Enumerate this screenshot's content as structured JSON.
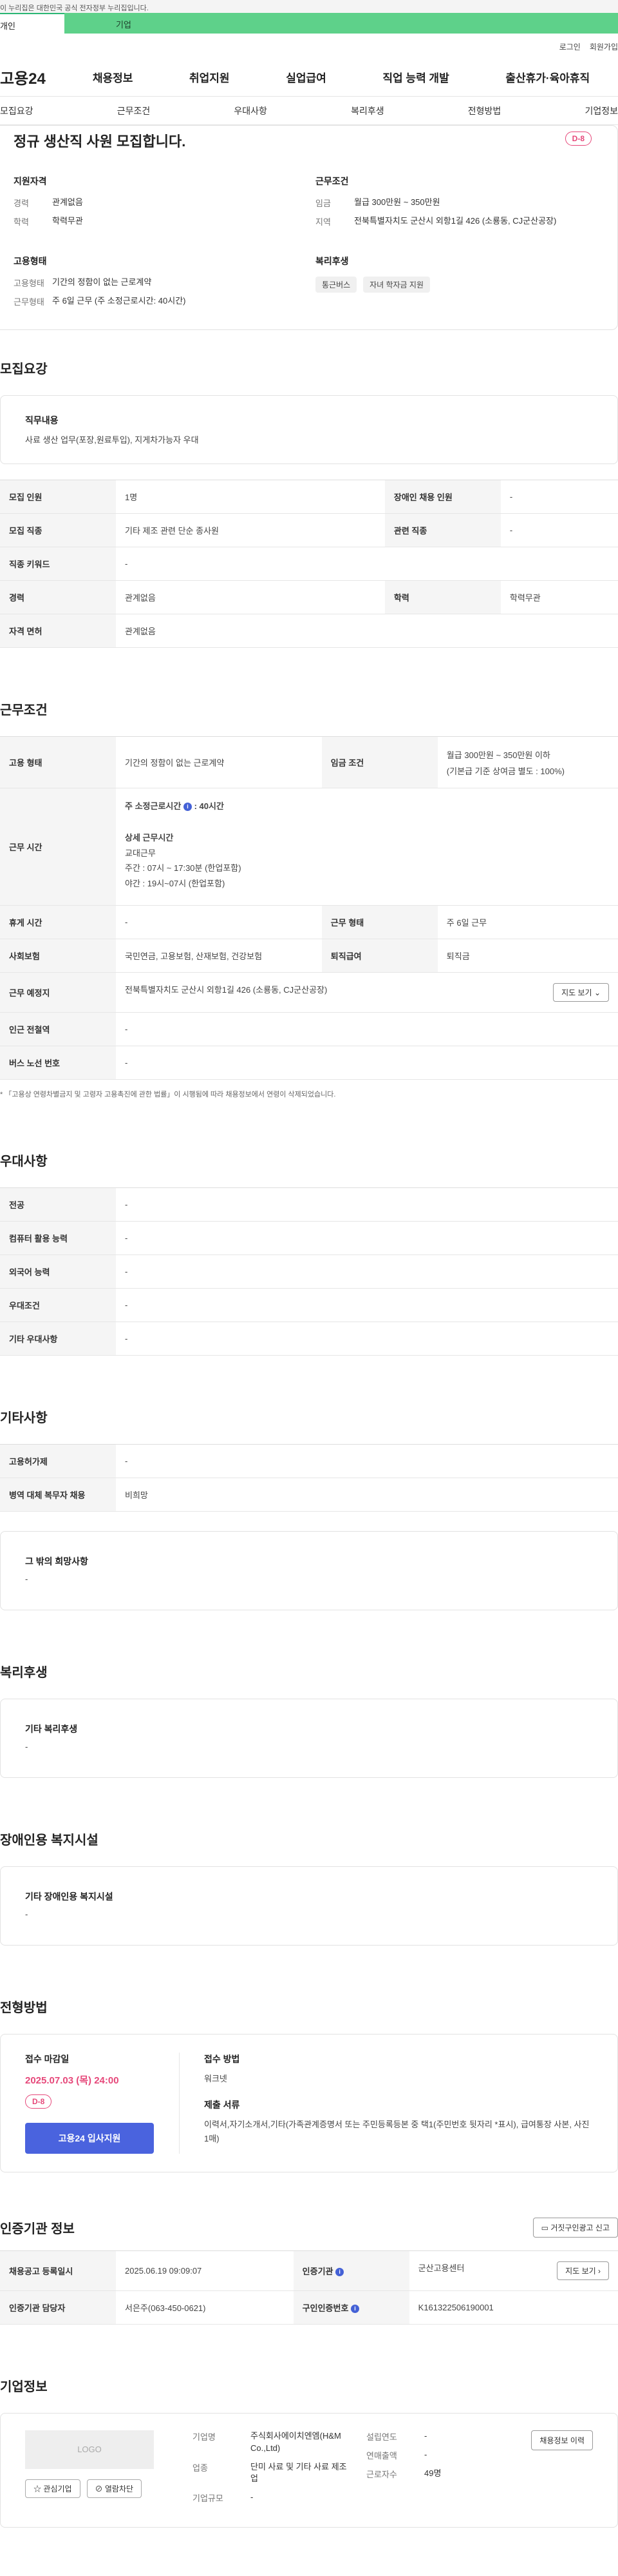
{
  "gov_banner": "이 누리집은 대한민국 공식 전자정부 누리집입니다.",
  "top_tabs": [
    "개인",
    "기업"
  ],
  "util_links": [
    "로그인",
    "회원가입"
  ],
  "brand": "고용24",
  "main_menu": [
    "채용정보",
    "취업지원",
    "실업급여",
    "직업 능력 개발",
    "출산휴가·육아휴직"
  ],
  "sub_nav": [
    "모집요강",
    "근무조건",
    "우대사항",
    "복리후생",
    "전형방법",
    "기업정보"
  ],
  "summary": {
    "title": "정규 생산직 사원 모집합니다.",
    "dday": "D-8",
    "qual_title": "지원자격",
    "qual": [
      {
        "k": "경력",
        "v": "관계없음"
      },
      {
        "k": "학력",
        "v": "학력무관"
      }
    ],
    "cond_title": "근무조건",
    "cond": [
      {
        "k": "임금",
        "v": "월급 300만원 ~ 350만원"
      },
      {
        "k": "지역",
        "v": "전북특별자치도 군산시 외항1길 426 (소룡동, CJ군산공장)"
      }
    ],
    "emp_title": "고용형태",
    "emp": [
      {
        "k": "고용형태",
        "v": "기간의 정함이 없는 근로계약"
      },
      {
        "k": "근무형태",
        "v": "주 6일 근무 (주 소정근로시간: 40시간)"
      }
    ],
    "welfare_title": "복리후생",
    "welfare_chips": [
      "통근버스",
      "자녀 학자금 지원"
    ]
  },
  "recruit": {
    "title": "모집요강",
    "duty_title": "직무내용",
    "duty_text": "사료 생산 업무(포장,원료투입), 지게차가능자 우대",
    "rows": [
      [
        "모집 인원",
        "1명",
        "장애인 채용 인원",
        "-"
      ],
      [
        "모집 직종",
        "기타 제조 관련 단순 종사원",
        "관련 직종",
        "-"
      ],
      [
        "직종 키워드",
        "-"
      ],
      [
        "경력",
        "관계없음",
        "학력",
        "학력무관"
      ],
      [
        "자격 면허",
        "관계없음"
      ]
    ]
  },
  "work": {
    "title": "근무조건",
    "emp_type_h": "고용 형태",
    "emp_type_v": "기간의 정함이 없는 근로계약",
    "wage_h": "임금 조건",
    "wage_v1": "월급 300만원 ~ 350만원 이하",
    "wage_v2": "(기본급 기준 상여금 별도 : 100%)",
    "hours_h": "근무 시간",
    "hours_week": "주 소정근로시간",
    "hours_week_v": ": 40시간",
    "hours_detail_title": "상세 근무시간",
    "hours_lines": [
      "교대근무",
      "주간 : 07시 ~ 17:30분 (한업포함)",
      "야간 : 19시~07시 (한업포함)"
    ],
    "rest_h": "휴게 시간",
    "rest_v": "-",
    "form_h": "근무 형태",
    "form_v": "주 6일 근무",
    "ins_h": "사회보험",
    "ins_v": "국민연금, 고용보험, 산재보험, 건강보험",
    "sev_h": "퇴직급여",
    "sev_v": "퇴직금",
    "place_h": "근무 예정지",
    "place_v": "전북특별자치도 군산시 외항1길 426 (소룡동, CJ군산공장)",
    "map_btn": "지도 보기",
    "station_h": "인근 전철역",
    "station_v": "-",
    "bus_h": "버스 노선 번호",
    "bus_v": "-",
    "note": "* 「고용상 연령차별금지 및 고령자 고용촉진에 관한 법률」이 시행됨에 따라 채용정보에서 연령이 삭제되었습니다."
  },
  "pref": {
    "title": "우대사항",
    "rows": [
      [
        "전공",
        "-"
      ],
      [
        "컴퓨터 활용 능력",
        "-"
      ],
      [
        "외국어 능력",
        "-"
      ],
      [
        "우대조건",
        "-"
      ],
      [
        "기타 우대사항",
        "-"
      ]
    ]
  },
  "etc": {
    "title": "기타사항",
    "rows": [
      [
        "고용허가제",
        "-"
      ],
      [
        "병역 대체 복무자 채용",
        "비희망"
      ]
    ],
    "box_title": "그 밖의 희망사항",
    "box_text": "-"
  },
  "welfare": {
    "title": "복리후생",
    "box_title": "기타 복리후생",
    "box_text": "-"
  },
  "disability": {
    "title": "장애인용 복지시설",
    "box_title": "기타 장애인용 복지시설",
    "box_text": "-"
  },
  "apply": {
    "title": "전형방법",
    "deadline_label": "접수 마감일",
    "deadline": "2025.07.03 (목) 24:00",
    "dday": "D-8",
    "apply_btn": "고용24 입사지원",
    "method_label": "접수 방법",
    "method": "워크넷",
    "docs_label": "제출 서류",
    "docs": "이력서,자기소개서,기타(가족관계증명서 또는 주민등록등본 중 택1(주민번호 뒷자리 *표시), 급여통장 사본, 사진 1매)"
  },
  "agency": {
    "title": "인증기관 정보",
    "report_btn": "거짓구인광고 신고",
    "rows": [
      [
        "채용공고 등록일시",
        "2025.06.19 09:09:07",
        "인증기관",
        "군산고용센터"
      ],
      [
        "인증기관 담당자",
        "서은주(063-450-0621)",
        "구인인증번호",
        "K161322506190001"
      ]
    ],
    "map_btn": "지도 보기"
  },
  "company": {
    "title": "기업정보",
    "logo": "LOGO",
    "btn_interest": "관심기업",
    "btn_block": "열람차단",
    "name_k": "기업명",
    "name_v": "주식회사에이치엔엠(H&M Co.,Ltd)",
    "ind_k": "업종",
    "ind_v": "단미 사료 및 기타 사료 제조업",
    "scale_k": "기업규모",
    "scale_v": "-",
    "year_k": "설립연도",
    "year_v": "-",
    "sales_k": "연매출액",
    "sales_v": "-",
    "emp_k": "근로자수",
    "emp_v": "49명",
    "history_btn": "채용정보 이력"
  },
  "colors": {
    "accent": "#4a63de",
    "dday": "#e6487a",
    "green": "#5ed18a"
  }
}
